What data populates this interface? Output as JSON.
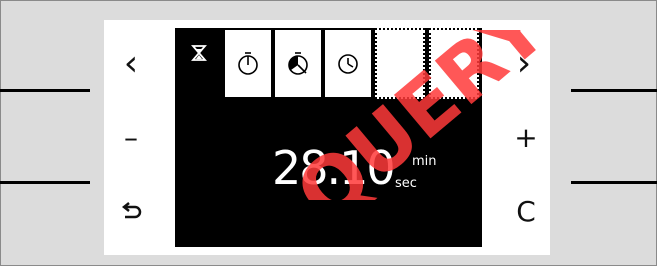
{
  "buttons": {
    "left_top": "‹",
    "left_middle": "–",
    "right_top": "›",
    "right_middle": "+",
    "right_bottom": "C"
  },
  "tabs": [
    {
      "name": "hourglass",
      "icon": "hourglass-icon"
    },
    {
      "name": "timer-full",
      "icon": "timer-icon"
    },
    {
      "name": "timer-half",
      "icon": "timer-half-icon"
    },
    {
      "name": "clock",
      "icon": "clock-icon"
    },
    {
      "name": "empty-1",
      "icon": ""
    },
    {
      "name": "empty-2",
      "icon": ""
    }
  ],
  "display": {
    "time_value": "28.10",
    "unit_min": "min",
    "unit_sec": "sec"
  },
  "watermark": {
    "text": "QUERY"
  },
  "colors": {
    "screen_bg": "#000000",
    "panel_bg": "#ffffff",
    "frame_bg": "#dcdcdc",
    "watermark": "#ff2a2a"
  }
}
